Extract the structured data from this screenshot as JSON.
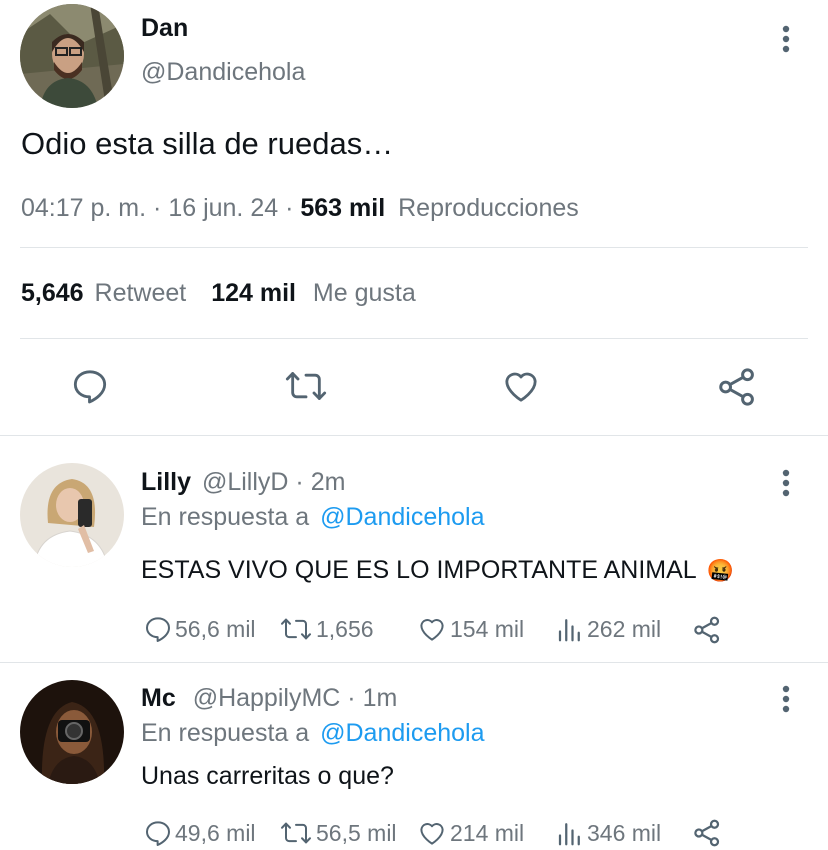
{
  "main_tweet": {
    "author_name": "Dan",
    "author_handle": "@Dandicehola",
    "text": "Odio esta silla de ruedas…",
    "time": "04:17 p. m.",
    "sep1": "·",
    "date": "16 jun. 24",
    "sep2": "·",
    "views_count": "563 mil",
    "views_label": "Reproducciones",
    "retweets_count": "5,646",
    "retweets_label": "Retweet",
    "likes_count": "124 mil",
    "likes_label": "Me gusta"
  },
  "replies": [
    {
      "name": "Lilly",
      "handle": "@LillyD",
      "dot": "·",
      "age": "2m",
      "reply_prefix": "En respuesta a",
      "reply_to": "@Dandicehola",
      "text": "ESTAS VIVO QUE ES LO IMPORTANTE ANIMAL",
      "emoji": "🤬",
      "replies": "56,6 mil",
      "retweets": "1,656",
      "likes": "154 mil",
      "views": "262 mil"
    },
    {
      "name": "Mc",
      "handle": "@HappilyMC",
      "dot": "·",
      "age": "1m",
      "reply_prefix": "En respuesta a",
      "reply_to": "@Dandicehola",
      "text": "Unas carreritas o que?",
      "replies": "49,6 mil",
      "retweets": "56,5 mil",
      "likes": "214 mil",
      "views": "346 mil"
    }
  ],
  "icons": [
    "more-icon",
    "reply-icon",
    "retweet-icon",
    "like-icon",
    "share-icon",
    "views-icon"
  ],
  "colors": {
    "link": "#1d9bf0",
    "secondary": "#6e767d",
    "primary": "#0f1419",
    "divider": "#e1e5e8"
  }
}
